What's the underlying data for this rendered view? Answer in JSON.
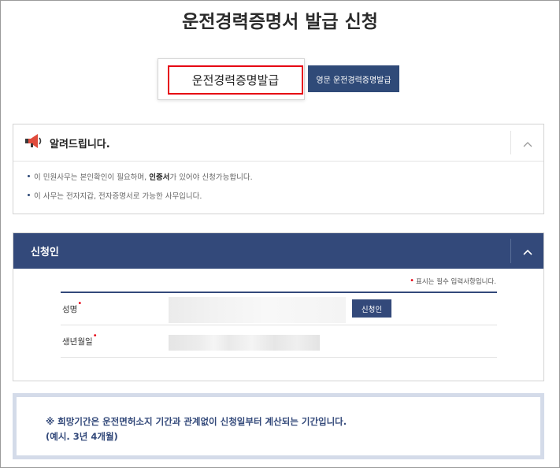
{
  "page": {
    "title": "운전경력증명서 발급 신청"
  },
  "tabs": {
    "primary_label": "운전경력증명발급",
    "secondary_label": "영문 운전경력증명발급"
  },
  "notice": {
    "icon": "megaphone-icon",
    "title": "알려드립니다.",
    "toggle_icon": "chevron-up-icon",
    "items": [
      {
        "pre": "이 민원사무는 본인확인이 필요하며, ",
        "bold": "인증서",
        "post": "가 있어야 신청가능합니다."
      },
      {
        "pre": "이 사무는 전자지갑, 전자증명서로 가능한 사무입니다.",
        "bold": "",
        "post": ""
      }
    ]
  },
  "applicant": {
    "title": "신청인",
    "toggle_icon": "chevron-up-icon",
    "required_note": "표시는 필수 입력사항입니다.",
    "required_mark": "•",
    "fields": [
      {
        "label": "성명",
        "button_label": "신청인"
      },
      {
        "label": "생년월일"
      }
    ]
  },
  "info": {
    "line1": "※ 희망기간은 운전면허소지 기간과 관계없이 신청일부터 계산되는 기간입니다.",
    "line2": "(예시. 3년 4개월)"
  },
  "colors": {
    "navy": "#33497a",
    "highlight_red": "#e60012"
  }
}
